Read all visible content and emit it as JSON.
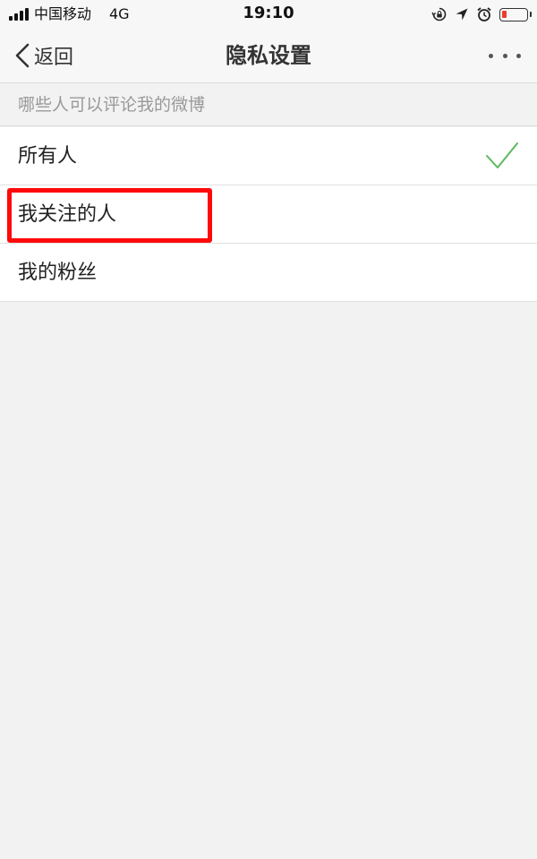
{
  "status_bar": {
    "carrier": "中国移动",
    "network": "4G",
    "time": "19:10",
    "battery_color": "#ee3b2f"
  },
  "nav": {
    "back_label": "返回",
    "title": "隐私设置",
    "more_icon": "more-dots-icon"
  },
  "section": {
    "header": "哪些人可以评论我的微博"
  },
  "options": [
    {
      "label": "所有人",
      "selected": true
    },
    {
      "label": "我关注的人",
      "selected": false,
      "highlighted": true
    },
    {
      "label": "我的粉丝",
      "selected": false
    }
  ],
  "colors": {
    "check": "#5cb85c",
    "highlight": "#ff0a0a",
    "background": "#f2f2f2"
  }
}
